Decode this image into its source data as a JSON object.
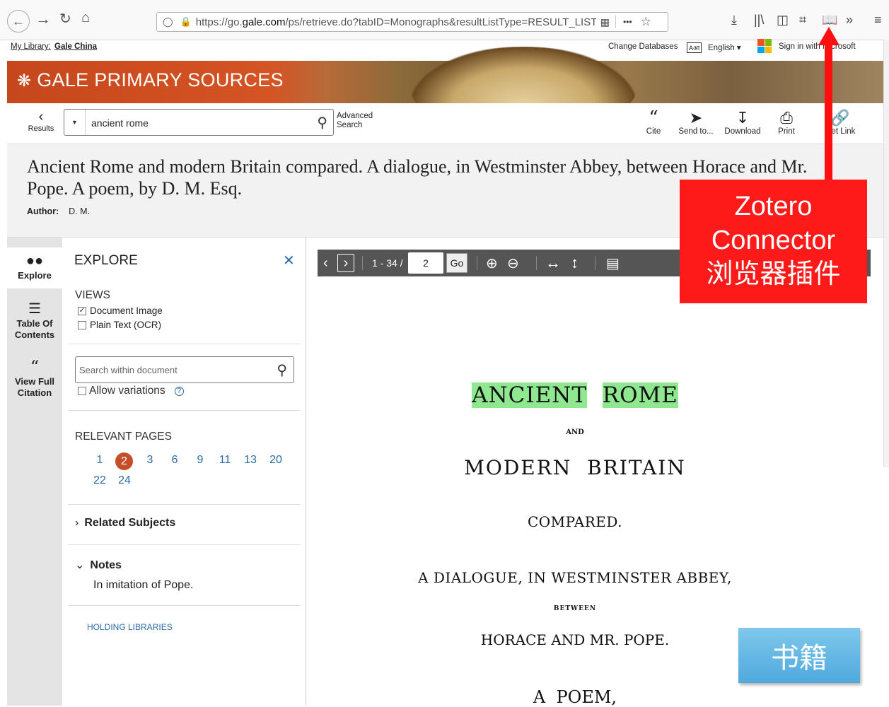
{
  "browser": {
    "url_prefix": "https://go.",
    "url_domain": "gale.com",
    "url_rest": "/ps/retrieve.do?tabID=Monographs&resultListType=RESULT_LIST",
    "more": "•••"
  },
  "libbar": {
    "my_library_label": "My Library:",
    "library_name": "Gale China",
    "change_db": "Change Databases",
    "lang_icon": "Aआ",
    "language": "English",
    "sign_in": "Sign in with Microsoft"
  },
  "banner": {
    "brand": "GALE PRIMARY SOURCES"
  },
  "search": {
    "results_label": "Results",
    "query": "ancient rome",
    "advanced_line1": "Advanced",
    "advanced_line2": "Search"
  },
  "tools": {
    "cite": "Cite",
    "send": "Send to...",
    "download": "Download",
    "print": "Print",
    "getlink": "Get Link"
  },
  "document": {
    "title": "Ancient Rome and modern Britain compared. A dialogue, in Westminster Abbey, between Horace and Mr. Pope. A poem, by D. M. Esq.",
    "author_label": "Author:",
    "author": "D. M."
  },
  "rail": {
    "explore": "Explore",
    "toc1": "Table Of",
    "toc2": "Contents",
    "cite1": "View Full",
    "cite2": "Citation"
  },
  "explore": {
    "title": "EXPLORE",
    "views_heading": "VIEWS",
    "view_image": "Document Image",
    "view_ocr": "Plain Text (OCR)",
    "search_placeholder": "Search within document",
    "allow_variations": "Allow variations",
    "relevant_heading": "RELEVANT PAGES",
    "pages": [
      "1",
      "2",
      "3",
      "6",
      "9",
      "11",
      "13",
      "20",
      "22",
      "24"
    ],
    "current_page": "2",
    "related_subjects": "Related Subjects",
    "notes": "Notes",
    "notes_text": "In imitation of Pope.",
    "holding": "HOLDING LIBRARIES"
  },
  "viewer": {
    "range": "1 - 34 /",
    "page_value": "2",
    "go": "Go"
  },
  "scan": {
    "line1a": "ANCIENT",
    "line1b": "ROME",
    "and": "AND",
    "line2": "MODERN  BRITAIN",
    "compared": "COMPARED.",
    "dialogue": "A DIALOGUE, IN WESTMINSTER ABBEY,",
    "between": "BETWEEN",
    "horace": "HORACE AND MR. POPE.",
    "poem": "A  POEM,"
  },
  "annotations": {
    "zotero_line1": "Zotero",
    "zotero_line2": "Connector",
    "zotero_line3": "浏览器插件",
    "book_label": "书籍"
  },
  "colors": {
    "banner_orange": "#d55424",
    "highlight": "#8fe88f",
    "link_blue": "#2b6aa6",
    "current_page": "#c44d2a",
    "annotation_red": "#ff1a1a",
    "annotation_blue": "#4fa9dc"
  },
  "icons": {
    "back": "back-arrow-icon",
    "zotero": "book-icon"
  }
}
